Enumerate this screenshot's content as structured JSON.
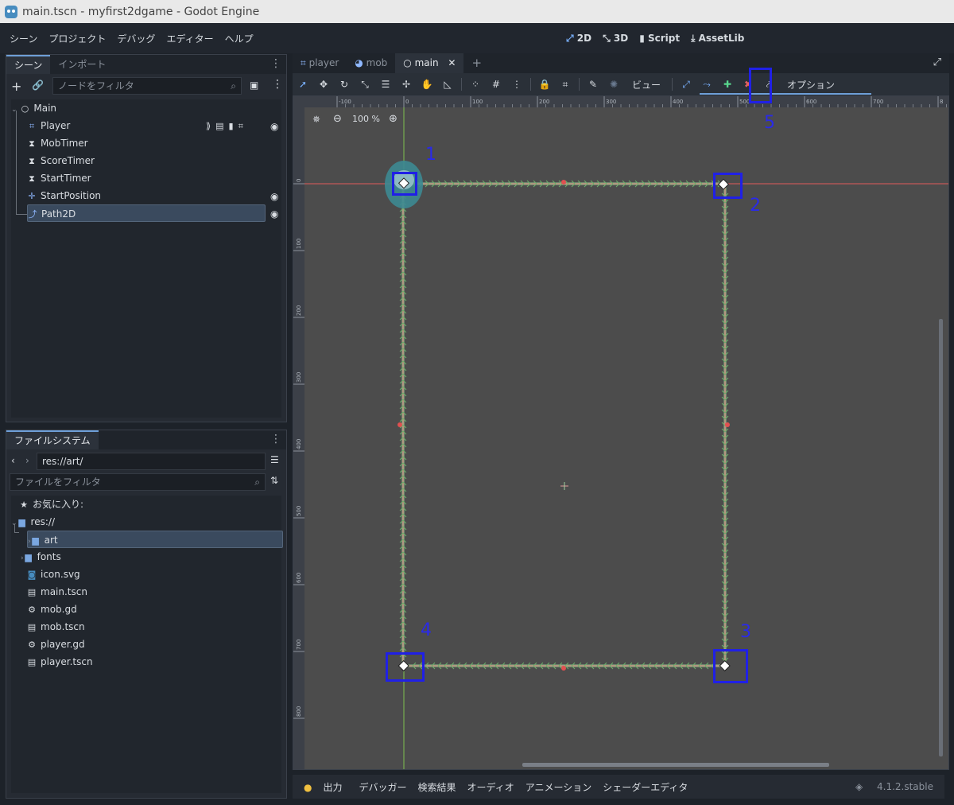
{
  "window": {
    "title": "main.tscn - myfirst2dgame - Godot Engine"
  },
  "menu": [
    "シーン",
    "プロジェクト",
    "デバッグ",
    "エディター",
    "ヘルプ"
  ],
  "workspaces": {
    "w2d": "2D",
    "w3d": "3D",
    "script": "Script",
    "assetlib": "AssetLib"
  },
  "scene_panel": {
    "tabs": [
      "シーン",
      "インポート"
    ],
    "filter_placeholder": "ノードをフィルタ",
    "nodes": [
      {
        "name": "Main",
        "icon": "node-icon"
      },
      {
        "name": "Player",
        "icon": "area2d-icon"
      },
      {
        "name": "MobTimer",
        "icon": "timer-icon"
      },
      {
        "name": "ScoreTimer",
        "icon": "timer-icon"
      },
      {
        "name": "StartTimer",
        "icon": "timer-icon"
      },
      {
        "name": "StartPosition",
        "icon": "marker2d-icon"
      },
      {
        "name": "Path2D",
        "icon": "path2d-icon"
      }
    ]
  },
  "filesystem_panel": {
    "tab": "ファイルシステム",
    "path": "res://art/",
    "filter_placeholder": "ファイルをフィルタ",
    "favorites": "お気に入り:",
    "items": [
      {
        "name": "res://",
        "icon": "folder-icon"
      },
      {
        "name": "art",
        "icon": "folder-icon"
      },
      {
        "name": "fonts",
        "icon": "folder-icon"
      },
      {
        "name": "icon.svg",
        "icon": "image-icon"
      },
      {
        "name": "main.tscn",
        "icon": "scene-icon"
      },
      {
        "name": "mob.gd",
        "icon": "gear-icon"
      },
      {
        "name": "mob.tscn",
        "icon": "scene-icon"
      },
      {
        "name": "player.gd",
        "icon": "gear-icon"
      },
      {
        "name": "player.tscn",
        "icon": "scene-icon"
      }
    ]
  },
  "editor_tabs": [
    "player",
    "mob",
    "main"
  ],
  "toolbar": {
    "view": "ビュー",
    "options": "オプション"
  },
  "viewport": {
    "zoom": "100 %",
    "ruler_h": [
      "-100",
      "0",
      "100",
      "200",
      "300",
      "400",
      "500",
      "600",
      "700",
      "8"
    ],
    "ruler_v": [
      "0",
      "100",
      "200",
      "300",
      "400",
      "500",
      "600",
      "700",
      "800"
    ],
    "annotations": [
      "1",
      "2",
      "3",
      "4",
      "5"
    ]
  },
  "bottom": {
    "tabs": [
      "出力",
      "デバッガー",
      "検索結果",
      "オーディオ",
      "アニメーション",
      "シェーダーエディタ"
    ],
    "version": "4.1.2.stable"
  },
  "colors": {
    "accent": "#6e9fd8",
    "annotation": "#2020e6",
    "path": "#a8d8a8",
    "point": "#e05050"
  }
}
